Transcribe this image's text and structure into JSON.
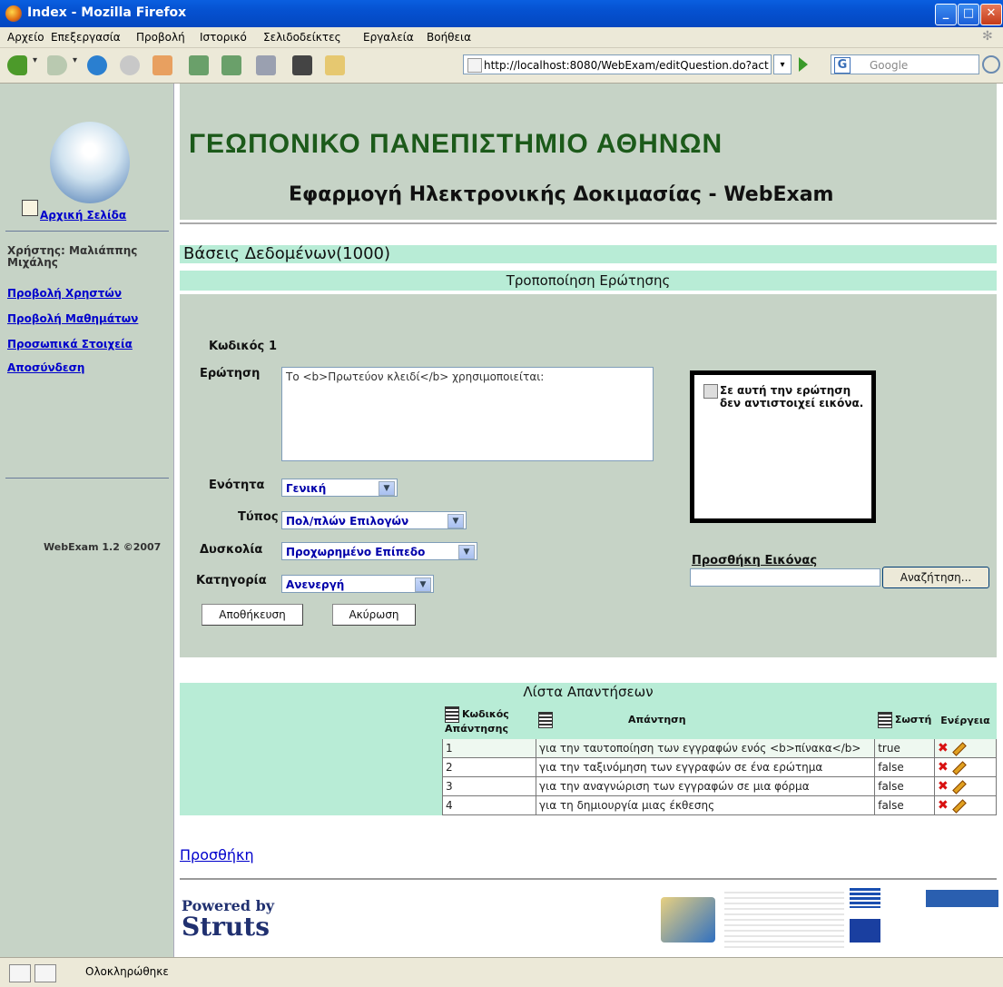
{
  "window": {
    "title": "Index - Mozilla Firefox"
  },
  "menu": [
    "Αρχείο",
    "Επεξεργασία",
    "Προβολή",
    "Ιστορικό",
    "Σελιδοδείκτες",
    "Εργαλεία",
    "Βοήθεια"
  ],
  "toolbar": {
    "url": "http://localhost:8080/WebExam/editQuestion.do?act",
    "search_placeholder": "Google"
  },
  "sidebar": {
    "home": "Αρχική Σελίδα",
    "user_label": "Χρήστης: Μαλιάππης Μιχάλης",
    "links": [
      "Προβολή Χρηστών",
      "Προβολή Μαθημάτων",
      "Προσωπικά Στοιχεία",
      "Αποσύνδεση"
    ],
    "version": "WebExam 1.2 ©2007"
  },
  "header": {
    "university": "ΓΕΩΠΟΝΙΚΟ ΠΑΝΕΠΙΣΤΗΜΙΟ ΑΘΗΝΩΝ",
    "app_title": "Εφαρμογή Ηλεκτρονικής Δοκιμασίας - WebExam"
  },
  "course": "Βάσεις Δεδομένων(1000)",
  "section_title": "Τροποποίηση Ερώτησης",
  "form": {
    "code_label": "Κωδικός",
    "code_value": "1",
    "question_label": "Ερώτηση",
    "question_value": "Το <b>Πρωτεύον κλειδί</b> χρησιμοποιείται:",
    "unit_label": "Ενότητα",
    "unit_value": "Γενική",
    "type_label": "Τύπος",
    "type_value": "Πολ/πλών Επιλογών",
    "difficulty_label": "Δυσκολία",
    "difficulty_value": "Προχωρημένο Επίπεδο",
    "category_label": "Κατηγορία",
    "category_value": "Ανενεργή",
    "save_button": "Αποθήκευση",
    "cancel_button": "Ακύρωση",
    "no_image_text": "Σε αυτή την ερώτηση δεν αντιστοιχεί εικόνα.",
    "add_image_label": "Προσθήκη Εικόνας",
    "browse_button": "Αναζήτηση..."
  },
  "answers": {
    "title": "Λίστα Απαντήσεων",
    "columns": [
      "Κωδικός Απάντησης",
      "Απάντηση",
      "Σωστή",
      "Ενέργεια"
    ],
    "rows": [
      {
        "id": "1",
        "text": "για την ταυτοποίηση των εγγραφών ενός <b>πίνακα</b>",
        "correct": "true"
      },
      {
        "id": "2",
        "text": "για την ταξινόμηση των εγγραφών σε ένα ερώτημα",
        "correct": "false"
      },
      {
        "id": "3",
        "text": "για την αναγνώριση των εγγραφών σε μια φόρμα",
        "correct": "false"
      },
      {
        "id": "4",
        "text": "για τη δημιουργία μιας έκθεσης",
        "correct": "false"
      }
    ],
    "add_link": "Προσθήκη"
  },
  "footer": {
    "powered_by": "Powered by",
    "struts": "Struts"
  },
  "status": {
    "text": "Ολοκληρώθηκε"
  }
}
